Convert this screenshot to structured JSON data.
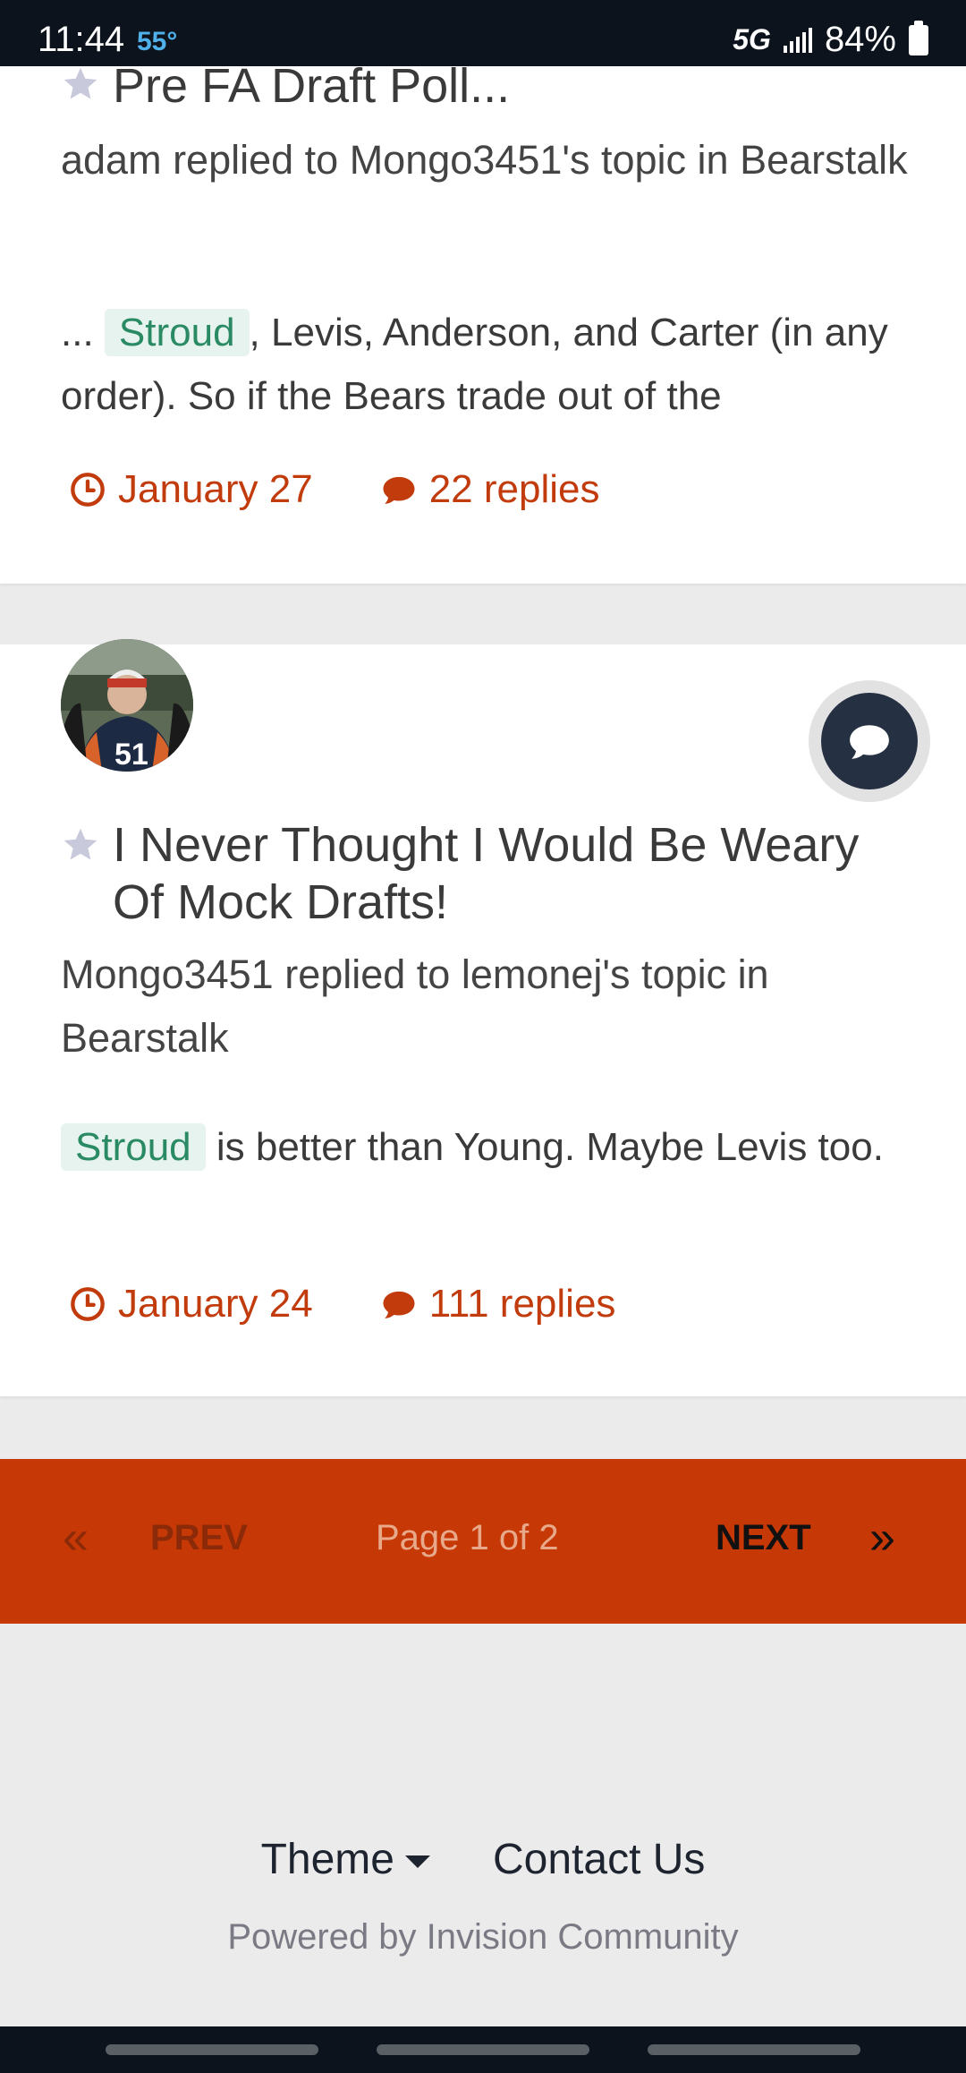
{
  "status_bar": {
    "time": "11:44",
    "temperature": "55°",
    "network": "5G",
    "battery": "84%"
  },
  "results": [
    {
      "title": "Pre FA Draft Poll...",
      "reply_line": "adam replied to Mongo3451's topic in Bearstalk",
      "snippet_before": "... ",
      "snippet_highlight": "Stroud",
      "snippet_after": ", Levis, Anderson, and Carter (in any order). So if the Bears trade out of the",
      "date": "January 27",
      "replies": "22 replies"
    },
    {
      "title": "I Never Thought I Would Be Weary Of Mock Drafts!",
      "reply_line": "Mongo3451 replied to lemonej's topic in Bearstalk",
      "snippet_before": "",
      "snippet_highlight": "Stroud",
      "snippet_after": " is better than Young. Maybe Levis too.",
      "date": "January 24",
      "replies": "111 replies"
    }
  ],
  "pagination": {
    "first_symbol": "«",
    "prev": "PREV",
    "page_info": "Page 1 of 2",
    "next": "NEXT",
    "last_symbol": "»"
  },
  "footer": {
    "theme": "Theme",
    "contact": "Contact Us",
    "powered_by": "Powered by Invision Community"
  },
  "colors": {
    "accent": "#c63806",
    "link": "#c23b0c",
    "highlight_bg": "#e6f3ee",
    "highlight_text": "#2a8a63",
    "status_bar": "#0d131c"
  },
  "icons": {
    "favorite": "star-icon",
    "date": "clock-icon",
    "replies": "comment-icon",
    "activity": "chat-bubble-icon",
    "theme": "caret-down-icon"
  }
}
